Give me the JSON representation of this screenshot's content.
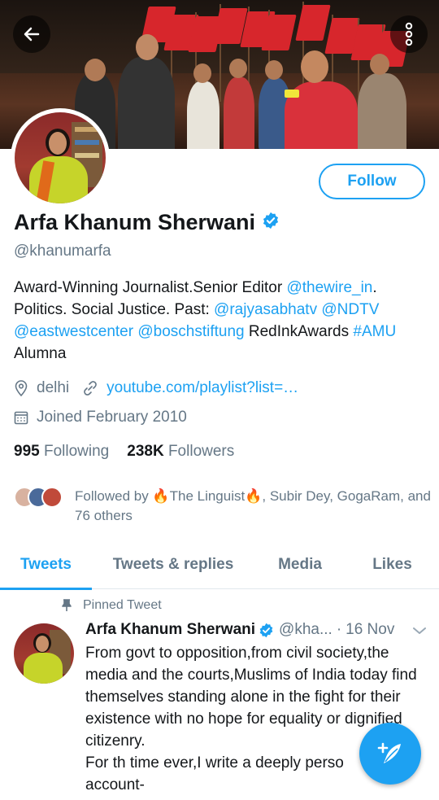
{
  "header": {
    "back_icon": "arrow-left-icon",
    "more_icon": "more-vertical-icon"
  },
  "profile": {
    "name": "Arfa Khanum Sherwani",
    "handle": "@khanumarfa",
    "follow_label": "Follow",
    "bio": {
      "t1": "Award-Winning Journalist.Senior Editor ",
      "l1": "@thewire_in",
      "t2": ". Politics. Social Justice. Past: ",
      "l2": "@rajyasabhatv",
      "t3": " ",
      "l3": "@NDTV",
      "t4": " ",
      "l4": "@eastwestcenter",
      "t5": " ",
      "l5": "@boschstiftung",
      "t6": " RedInkAwards ",
      "l6": "#AMU",
      "t7": " Alumna"
    },
    "location": "delhi",
    "website": "youtube.com/playlist?list=…",
    "joined": "Joined February 2010",
    "following_count": "995",
    "following_label": "Following",
    "followers_count": "238K",
    "followers_label": "Followers",
    "followed_by": "Followed by 🔥The Linguist🔥, Subir Dey, GogaRam, and 76 others"
  },
  "tabs": [
    {
      "label": "Tweets"
    },
    {
      "label": "Tweets & replies"
    },
    {
      "label": "Media"
    },
    {
      "label": "Likes"
    }
  ],
  "pinned_tweet": {
    "pinned_label": "Pinned Tweet",
    "author": "Arfa Khanum Sherwani",
    "handle": "@kha...",
    "separator": "·",
    "date": "16 Nov",
    "text": "From govt to opposition,from civil society,the media and the courts,Muslims of India today find themselves standing alone in the fight for their existence with no hope for equality or dignified citizenry.\nFor th time ever,I write a deeply perso\naccount-"
  },
  "colors": {
    "accent": "#1da1f2",
    "text": "#14171a",
    "secondary": "#657786"
  }
}
